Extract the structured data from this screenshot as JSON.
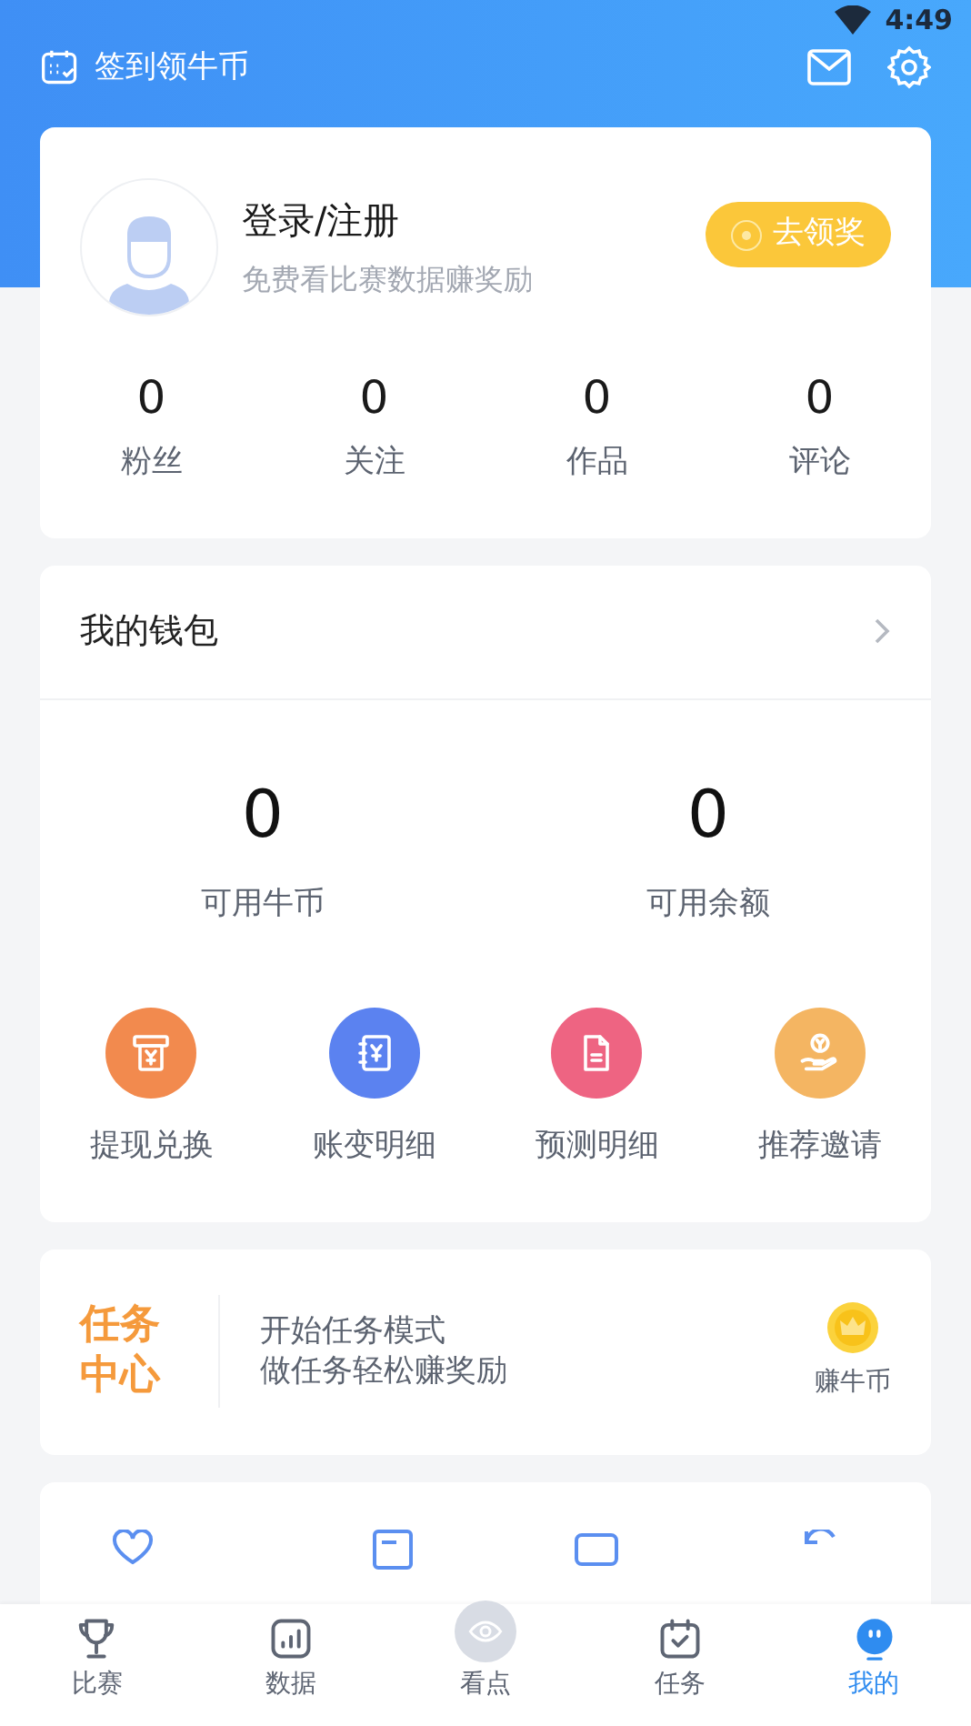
{
  "status_bar": {
    "time": "4:49"
  },
  "header": {
    "checkin_label": "签到领牛币"
  },
  "profile": {
    "name": "登录/注册",
    "subtitle": "免费看比赛数据赚奖励",
    "reward_button": "去领奖",
    "stats": [
      {
        "value": "0",
        "label": "粉丝"
      },
      {
        "value": "0",
        "label": "关注"
      },
      {
        "value": "0",
        "label": "作品"
      },
      {
        "value": "0",
        "label": "评论"
      }
    ]
  },
  "wallet": {
    "title": "我的钱包",
    "balances": [
      {
        "value": "0",
        "label": "可用牛币"
      },
      {
        "value": "0",
        "label": "可用余额"
      }
    ],
    "actions": [
      {
        "kind": "withdraw",
        "label": "提现兑换",
        "color": "#f28a4e"
      },
      {
        "kind": "ledger",
        "label": "账变明细",
        "color": "#5b82f0"
      },
      {
        "kind": "document",
        "label": "预测明细",
        "color": "#ee6482"
      },
      {
        "kind": "invite",
        "label": "推荐邀请",
        "color": "#f4b562"
      }
    ]
  },
  "task_center": {
    "title": "任务中心",
    "lines": [
      "开始任务模式",
      "做任务轻松赚奖励"
    ],
    "earn_label": "赚牛币"
  },
  "bottom_nav": [
    {
      "kind": "trophy",
      "label": "比赛",
      "selected": false
    },
    {
      "kind": "chart",
      "label": "数据",
      "selected": false
    },
    {
      "kind": "eye",
      "label": "看点",
      "selected": false
    },
    {
      "kind": "calendar",
      "label": "任务",
      "selected": false
    },
    {
      "kind": "face",
      "label": "我的",
      "selected": true
    }
  ]
}
